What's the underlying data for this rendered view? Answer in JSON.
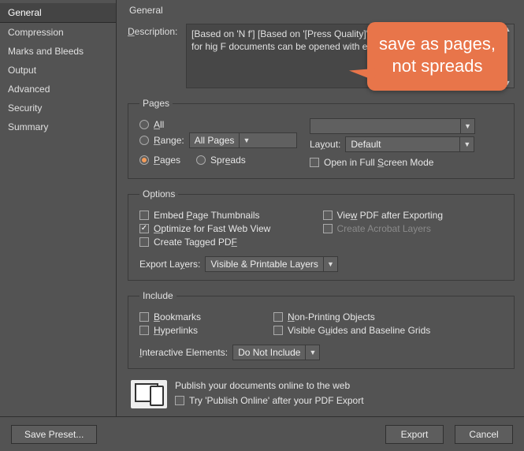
{
  "sidebar": {
    "items": [
      {
        "label": "General"
      },
      {
        "label": "Compression"
      },
      {
        "label": "Marks and Bleeds"
      },
      {
        "label": "Output"
      },
      {
        "label": "Advanced"
      },
      {
        "label": "Security"
      },
      {
        "label": "Summary"
      }
    ]
  },
  "main": {
    "title": "General",
    "description_label": "Description:",
    "description_text": "[Based on 'N                                                              f'] [Based on '[Press Quality]'] Use                                                             ocuments best suited for hig                                                        F documents can be opened with                                                        er."
  },
  "pages": {
    "legend": "Pages",
    "all": "All",
    "range": "Range:",
    "range_value": "All Pages",
    "pages": "Pages",
    "spreads": "Spreads",
    "layout_label": "Layout:",
    "layout_value": "Default",
    "fullscreen": "Open in Full Screen Mode"
  },
  "options": {
    "legend": "Options",
    "embed": "Embed Page Thumbnails",
    "optimize": "Optimize for Fast Web View",
    "tagged": "Create Tagged PDF",
    "view_after": "View PDF after Exporting",
    "acrobat_layers": "Create Acrobat Layers",
    "export_layers_label": "Export Layers:",
    "export_layers_value": "Visible & Printable Layers"
  },
  "include": {
    "legend": "Include",
    "bookmarks": "Bookmarks",
    "hyperlinks": "Hyperlinks",
    "nonprint": "Non-Printing Objects",
    "guides": "Visible Guides and Baseline Grids",
    "interactive_label": "Interactive Elements:",
    "interactive_value": "Do Not Include"
  },
  "publish": {
    "headline": "Publish your documents online to the web",
    "try": "Try 'Publish Online' after your PDF Export"
  },
  "buttons": {
    "save_preset": "Save Preset...",
    "export": "Export",
    "cancel": "Cancel"
  },
  "callout": {
    "text": "save as pages, not spreads"
  }
}
